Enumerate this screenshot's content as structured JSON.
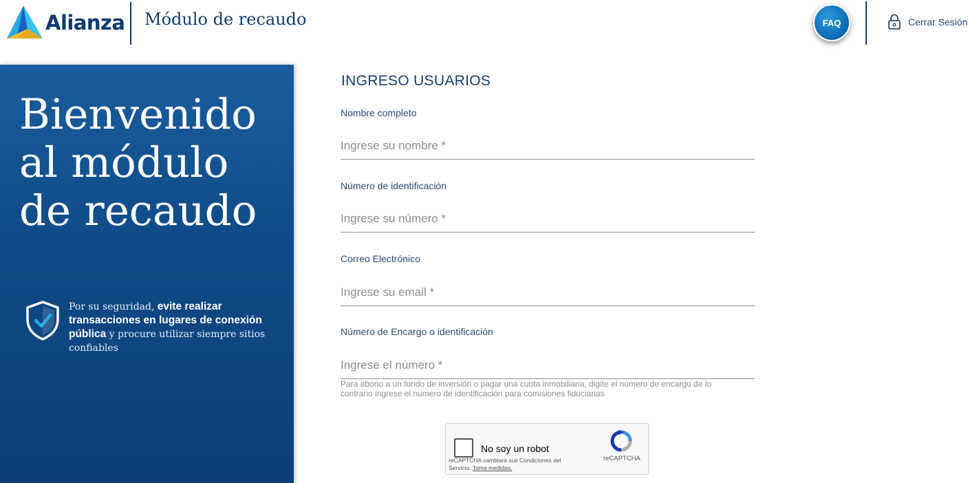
{
  "header": {
    "brand": "Alianza",
    "module_title": "Módulo de recaudo",
    "faq_label": "FAQ",
    "logout_label": "Cerrar Sesión"
  },
  "panel": {
    "welcome": "Bienvenido al módulo de recaudo",
    "security_prefix": "Por su seguridad,",
    "security_bold": "evite realizar transacciones en lugares de conexión pública",
    "security_suffix": "y procure utilizar siempre sitios confiables"
  },
  "form": {
    "title": "INGRESO USUARIOS",
    "fields": [
      {
        "label": "Nombre completo",
        "placeholder": "Ingrese su nombre *",
        "value": ""
      },
      {
        "label": "Número de identificación",
        "placeholder": "Ingrese su número *",
        "value": ""
      },
      {
        "label": "Correo Electrónico",
        "placeholder": "Ingrese su email *",
        "value": ""
      },
      {
        "label": "Número de Encargo o identificación",
        "placeholder": "Ingrese el número *",
        "value": ""
      }
    ],
    "help_text": "Para abono a un fondo de inversión o pagar una cuota inmobiliaria, digite el número de encargo de lo contrario ingrese el numero de identificación para comisiones fiduciarias"
  },
  "recaptcha": {
    "label": "No soy un robot",
    "terms": "reCAPTCHA cambiará sus Condiciones del Servicio.",
    "terms_link": "Toma medidas.",
    "brand": "reCAPTCHA"
  },
  "colors": {
    "brand_navy": "#0f3a6e",
    "panel_blue": "#0e4a86",
    "faq_blue": "#0a66b0",
    "logo_cyan": "#20b3e6",
    "shield_check": "#2aa8e0"
  },
  "icons": [
    "alianza-logo-icon",
    "lock-icon",
    "shield-check-icon",
    "recaptcha-icon"
  ]
}
